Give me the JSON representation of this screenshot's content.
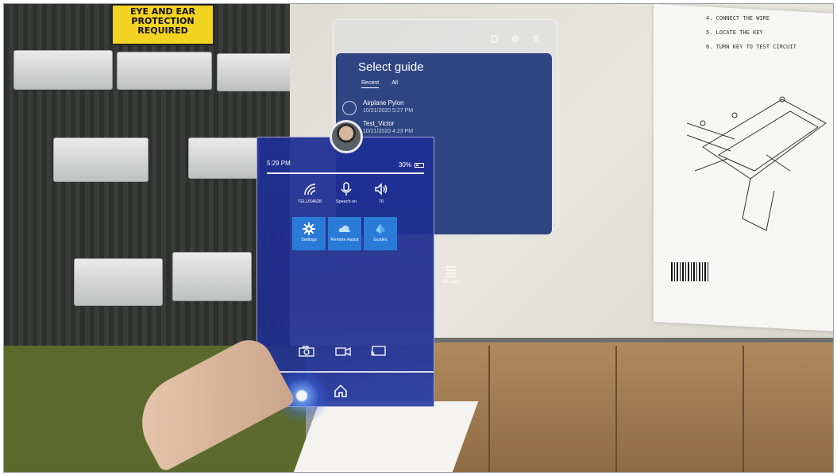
{
  "scene": {
    "sign_lines": [
      "EYE AND EAR",
      "PROTECTION",
      "REQUIRED"
    ],
    "paper_steps": [
      "4. CONNECT THE WIRE",
      "5. LOCATE THE KEY",
      "6. TURN KEY TO TEST CIRCUIT"
    ]
  },
  "guides_app": {
    "title": "Select guide",
    "tabs": [
      "Recent",
      "All"
    ],
    "items": [
      {
        "name": "Airplane Pylon",
        "date": "10/21/2020 5:27 PM"
      },
      {
        "name": "Test_Victor",
        "date": "10/21/2020 4:23 PM"
      }
    ],
    "top_icons": [
      "tag-icon",
      "settings-icon",
      "person-icon"
    ]
  },
  "all_apps": {
    "label": "All Apps",
    "icon": "list-icon"
  },
  "start_menu": {
    "time": "5:29 PM",
    "battery": "30%",
    "quick_settings": [
      {
        "label": "TELUS4628",
        "icon": "wifi-icon"
      },
      {
        "label": "Speech on",
        "icon": "microphone-icon"
      },
      {
        "label": "70",
        "icon": "volume-icon"
      }
    ],
    "tiles": [
      {
        "label": "Settings",
        "icon": "gear-icon"
      },
      {
        "label": "Remote Assist",
        "icon": "cloud-icon"
      },
      {
        "label": "Guides",
        "icon": "guides-icon"
      }
    ],
    "bottom_actions": [
      "camera-icon",
      "video-icon",
      "cast-icon"
    ],
    "home": "home-icon"
  },
  "colors": {
    "panel": "#1f2f94",
    "tile": "#2a7bd8",
    "guide_panel": "#1e3778"
  }
}
